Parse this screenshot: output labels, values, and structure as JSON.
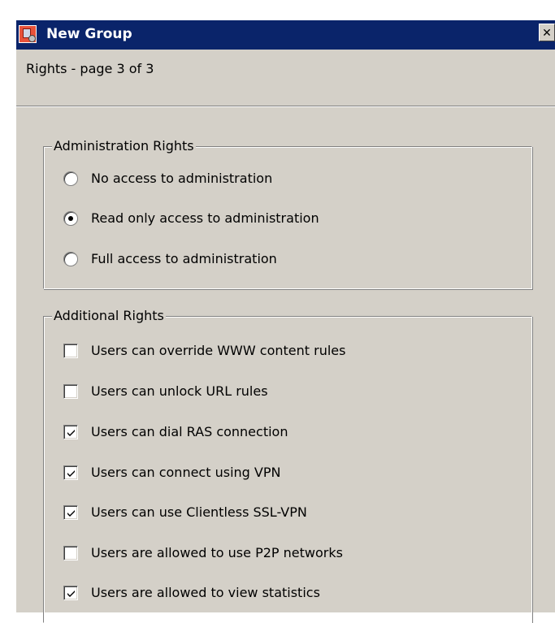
{
  "window": {
    "title": "New Group",
    "close_glyph": "✕",
    "app_icon": "group-app-icon"
  },
  "page": {
    "heading": "Rights - page 3 of 3"
  },
  "admin_rights": {
    "legend": "Administration Rights",
    "options": [
      {
        "label": "No access to administration",
        "selected": false
      },
      {
        "label": "Read only access to administration",
        "selected": true
      },
      {
        "label": "Full access to administration",
        "selected": false
      }
    ]
  },
  "additional_rights": {
    "legend": "Additional Rights",
    "options": [
      {
        "label": "Users can override WWW content rules",
        "checked": false
      },
      {
        "label": "Users can unlock URL rules",
        "checked": false
      },
      {
        "label": "Users can dial RAS connection",
        "checked": true
      },
      {
        "label": "Users can connect using VPN",
        "checked": true
      },
      {
        "label": "Users can use Clientless SSL-VPN",
        "checked": true
      },
      {
        "label": "Users are allowed to use P2P networks",
        "checked": false
      },
      {
        "label": "Users are allowed to view statistics",
        "checked": true
      }
    ]
  },
  "colors": {
    "titlebar": "#0a246a",
    "dialog_face": "#d4d0c8",
    "title_text": "#ffffff"
  }
}
